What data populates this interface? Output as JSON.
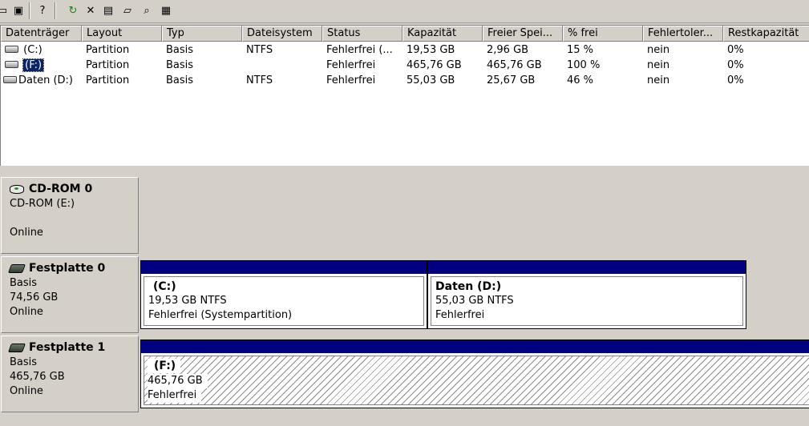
{
  "toolbar": {
    "buttons": [
      {
        "icon": "folder-icon",
        "glyph": "▭"
      },
      {
        "icon": "details-view-icon",
        "glyph": "▣"
      },
      {
        "icon": "help-icon",
        "glyph": "?"
      },
      {
        "icon": "refresh-icon",
        "glyph": "↻"
      },
      {
        "icon": "delete-icon",
        "glyph": "✕"
      },
      {
        "icon": "properties-icon",
        "glyph": "▤"
      },
      {
        "icon": "open-icon",
        "glyph": "▱"
      },
      {
        "icon": "explore-icon",
        "glyph": "⌕"
      },
      {
        "icon": "settings-icon",
        "glyph": "▦"
      }
    ]
  },
  "list": {
    "columns": [
      "Datenträger",
      "Layout",
      "Typ",
      "Dateisystem",
      "Status",
      "Kapazität",
      "Freier Spei...",
      "% frei",
      "Fehlertoler...",
      "Restkapazität"
    ],
    "rows": [
      {
        "name": "(C:)",
        "layout": "Partition",
        "type": "Basis",
        "fs": "NTFS",
        "status": "Fehlerfrei (...",
        "capacity": "19,53 GB",
        "free": "2,96 GB",
        "pct": "15 %",
        "fault": "nein",
        "overhead": "0%"
      },
      {
        "name": "(F:)",
        "layout": "Partition",
        "type": "Basis",
        "fs": "",
        "status": "Fehlerfrei",
        "capacity": "465,76 GB",
        "free": "465,76 GB",
        "pct": "100 %",
        "fault": "nein",
        "overhead": "0%"
      },
      {
        "name": "Daten (D:)",
        "layout": "Partition",
        "type": "Basis",
        "fs": "NTFS",
        "status": "Fehlerfrei",
        "capacity": "55,03 GB",
        "free": "25,67 GB",
        "pct": "46 %",
        "fault": "nein",
        "overhead": "0%"
      }
    ]
  },
  "disks": {
    "cdrom": {
      "name": "CD-ROM 0",
      "line1": "CD-ROM (E:)",
      "status": "Online"
    },
    "disk0": {
      "name": "Festplatte 0",
      "type": "Basis",
      "size": "74,56 GB",
      "status": "Online",
      "partitions": [
        {
          "name": "(C:)",
          "detail": "19,53 GB NTFS",
          "status": "Fehlerfrei (Systempartition)"
        },
        {
          "name": "Daten  (D:)",
          "detail": "55,03 GB NTFS",
          "status": "Fehlerfrei"
        }
      ]
    },
    "disk1": {
      "name": "Festplatte 1",
      "type": "Basis",
      "size": "465,76 GB",
      "status": "Online",
      "partitions": [
        {
          "name": "(F:)",
          "detail": "465,76 GB",
          "status": "Fehlerfrei"
        }
      ]
    }
  },
  "colors": {
    "partition_bar": "#000080",
    "selection": "#0a246a",
    "window_bg": "#d4d0c8"
  }
}
